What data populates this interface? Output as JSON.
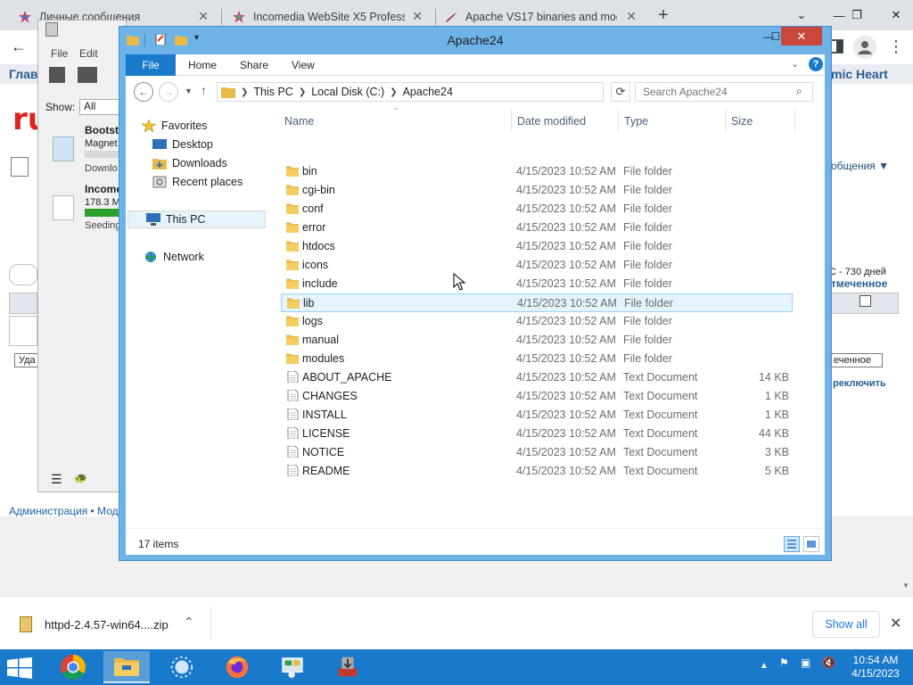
{
  "browser": {
    "tabs": [
      {
        "label": "Личные сообщения",
        "active": false
      },
      {
        "label": "Incomedia WebSite X5 Professio",
        "active": false
      },
      {
        "label": "Apache VS17 binaries and modu",
        "active": true
      }
    ],
    "window_controls": {
      "minimize": "—",
      "restore": "❐",
      "close": "✕"
    }
  },
  "background_page": {
    "nav_left": "Глав",
    "nav_right": "mic Heart",
    "client_menu": [
      "File",
      "Edit"
    ],
    "client_show_label": "Show:",
    "client_show_value": "All",
    "torrent_1_name": "Bootstr",
    "torrent_1_sub": "Magnet",
    "torrent_1_status": "Downlo",
    "torrent_2_name": "Income",
    "torrent_2_size": "178.3 M",
    "torrent_2_status": "Seeding",
    "msg_dropdown": "общения ▼",
    "days_text": "С - 730 дней",
    "marked_text": "тмеченное",
    "marked_button": "еченное",
    "delete_button": "Уда",
    "switch_link": "реключить",
    "footer_links": "Администрация • Мод",
    "logo": "ru"
  },
  "explorer": {
    "title": "Apache24",
    "ribbon_tabs": [
      "File",
      "Home",
      "Share",
      "View"
    ],
    "breadcrumb": [
      "This PC",
      "Local Disk (C:)",
      "Apache24"
    ],
    "search_placeholder": "Search Apache24",
    "nav_pane": {
      "favorites": "Favorites",
      "favorite_items": [
        "Desktop",
        "Downloads",
        "Recent places"
      ],
      "this_pc": "This PC",
      "network": "Network"
    },
    "columns": {
      "name": "Name",
      "date": "Date modified",
      "type": "Type",
      "size": "Size"
    },
    "files": [
      {
        "name": "bin",
        "date": "4/15/2023 10:52 AM",
        "type": "File folder",
        "size": "",
        "kind": "folder"
      },
      {
        "name": "cgi-bin",
        "date": "4/15/2023 10:52 AM",
        "type": "File folder",
        "size": "",
        "kind": "folder"
      },
      {
        "name": "conf",
        "date": "4/15/2023 10:52 AM",
        "type": "File folder",
        "size": "",
        "kind": "folder"
      },
      {
        "name": "error",
        "date": "4/15/2023 10:52 AM",
        "type": "File folder",
        "size": "",
        "kind": "folder"
      },
      {
        "name": "htdocs",
        "date": "4/15/2023 10:52 AM",
        "type": "File folder",
        "size": "",
        "kind": "folder"
      },
      {
        "name": "icons",
        "date": "4/15/2023 10:52 AM",
        "type": "File folder",
        "size": "",
        "kind": "folder"
      },
      {
        "name": "include",
        "date": "4/15/2023 10:52 AM",
        "type": "File folder",
        "size": "",
        "kind": "folder"
      },
      {
        "name": "lib",
        "date": "4/15/2023 10:52 AM",
        "type": "File folder",
        "size": "",
        "kind": "folder"
      },
      {
        "name": "logs",
        "date": "4/15/2023 10:52 AM",
        "type": "File folder",
        "size": "",
        "kind": "folder"
      },
      {
        "name": "manual",
        "date": "4/15/2023 10:52 AM",
        "type": "File folder",
        "size": "",
        "kind": "folder"
      },
      {
        "name": "modules",
        "date": "4/15/2023 10:52 AM",
        "type": "File folder",
        "size": "",
        "kind": "folder"
      },
      {
        "name": "ABOUT_APACHE",
        "date": "4/15/2023 10:52 AM",
        "type": "Text Document",
        "size": "14 KB",
        "kind": "text"
      },
      {
        "name": "CHANGES",
        "date": "4/15/2023 10:52 AM",
        "type": "Text Document",
        "size": "1 KB",
        "kind": "text"
      },
      {
        "name": "INSTALL",
        "date": "4/15/2023 10:52 AM",
        "type": "Text Document",
        "size": "1 KB",
        "kind": "text"
      },
      {
        "name": "LICENSE",
        "date": "4/15/2023 10:52 AM",
        "type": "Text Document",
        "size": "44 KB",
        "kind": "text"
      },
      {
        "name": "NOTICE",
        "date": "4/15/2023 10:52 AM",
        "type": "Text Document",
        "size": "3 KB",
        "kind": "text"
      },
      {
        "name": "README",
        "date": "4/15/2023 10:52 AM",
        "type": "Text Document",
        "size": "5 KB",
        "kind": "text"
      }
    ],
    "hovered_item": "lib",
    "status": "17 items"
  },
  "downloads": {
    "file": "httpd-2.4.57-win64....zip",
    "show_all": "Show all"
  },
  "taskbar": {
    "time": "10:54 AM",
    "date": "4/15/2023"
  },
  "colors": {
    "explorer_frame": "#6db3e8",
    "accent": "#1979ca",
    "hover_row": "#e5f3fb",
    "hover_border": "#99d1ff",
    "close_red": "#c9483b",
    "folder": "#e8b948"
  }
}
